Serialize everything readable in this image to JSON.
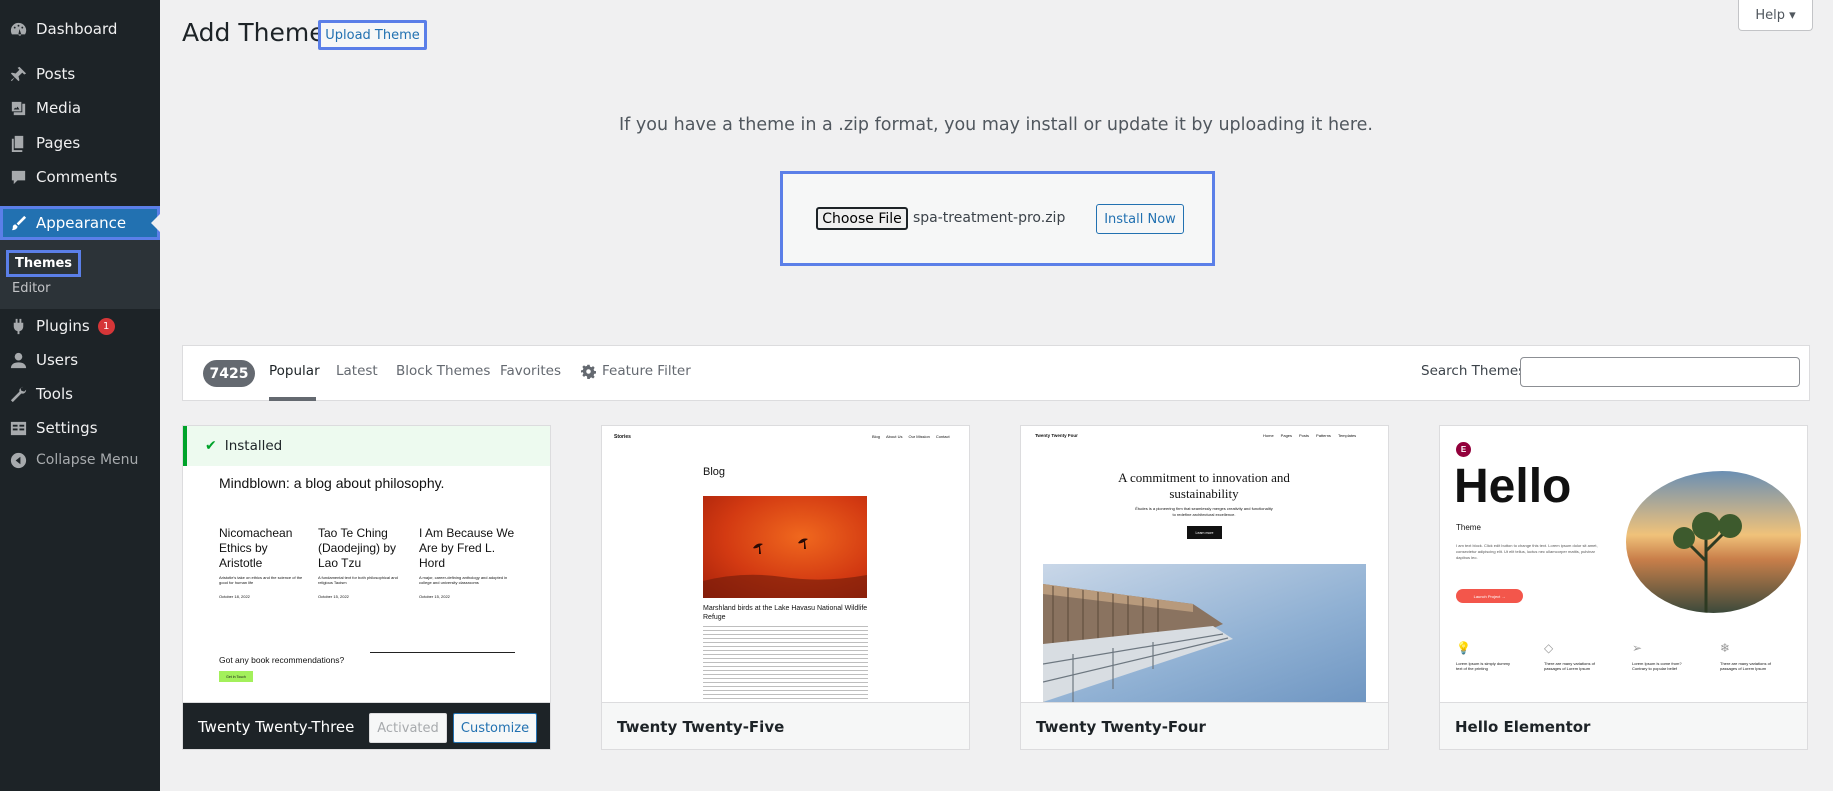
{
  "sidebar": {
    "items": [
      {
        "label": "Dashboard",
        "icon": "dashboard-icon"
      },
      {
        "label": "Posts",
        "icon": "pin-icon"
      },
      {
        "label": "Media",
        "icon": "media-icon"
      },
      {
        "label": "Pages",
        "icon": "pages-icon"
      },
      {
        "label": "Comments",
        "icon": "comment-icon"
      },
      {
        "label": "Appearance",
        "icon": "brush-icon"
      },
      {
        "label": "Plugins",
        "icon": "plugin-icon",
        "badge": "1"
      },
      {
        "label": "Users",
        "icon": "users-icon"
      },
      {
        "label": "Tools",
        "icon": "wrench-icon"
      },
      {
        "label": "Settings",
        "icon": "settings-icon"
      },
      {
        "label": "Collapse Menu",
        "icon": "collapse-icon"
      }
    ],
    "submenu": [
      {
        "label": "Themes"
      },
      {
        "label": "Editor"
      }
    ]
  },
  "header": {
    "title": "Add Themes",
    "upload_button": "Upload Theme",
    "help_button": "Help ▾"
  },
  "upload": {
    "instructions": "If you have a theme in a .zip format, you may install or update it by uploading it here.",
    "choose_file": "Choose File",
    "file_name": "spa-treatment-pro.zip",
    "install_button": "Install Now"
  },
  "filter": {
    "count": "7425",
    "tabs": [
      "Popular",
      "Latest",
      "Block Themes",
      "Favorites"
    ],
    "feature_filter": "Feature Filter",
    "search_label": "Search Themes"
  },
  "themes": [
    {
      "name": "Twenty Twenty-Three",
      "installed": "Installed",
      "activated": "Activated",
      "customize": "Customize",
      "preview": {
        "heading": "Mindblown: a blog about philosophy.",
        "posts": [
          {
            "title": "Nicomachean Ethics by Aristotle",
            "text": "Aristotle's take on ethics and the science of the good for human life",
            "date": "October 18, 2022"
          },
          {
            "title": "Tao Te Ching (Daodejing) by Lao Tzu",
            "text": "A fundamental text for both philosophical and religious Taoism",
            "date": "October 15, 2022"
          },
          {
            "title": "I Am Because We Are by Fred L. Hord",
            "text": "A major, career-defining anthology and adopted in college and university classrooms",
            "date": "October 15, 2022"
          }
        ],
        "question": "Got any book recommendations?",
        "cta": "Get In Touch"
      }
    },
    {
      "name": "Twenty Twenty-Five",
      "preview": {
        "site": "Stories",
        "nav": [
          "Blog",
          "About Us",
          "Our Mission",
          "Contact"
        ],
        "heading": "Blog",
        "caption": "Marshland birds at the Lake Havasu National Wildlife Refuge"
      }
    },
    {
      "name": "Twenty Twenty-Four",
      "preview": {
        "site": "Twenty Twenty Four",
        "nav": [
          "Home",
          "Pages",
          "Posts",
          "Patterns",
          "Templates"
        ],
        "heading": "A commitment to innovation and sustainability",
        "text": "Études is a pioneering firm that seamlessly merges creativity and functionality to redefine architectural excellence.",
        "cta": "Learn more"
      }
    },
    {
      "name": "Hello Elementor",
      "preview": {
        "logo": "E",
        "heading": "Hello",
        "subheading": "Theme",
        "text": "I am text block. Click edit button to change this text. Lorem ipsum dolor sit amet, consectetur adipiscing elit. Ut elit tellus, luctus nec ullamcorper mattis, pulvinar dapibus leo.",
        "cta": "Launch Project →",
        "features": [
          {
            "icon": "bulb-icon",
            "text": "Lorem Ipsum is simply dummy text of the printing"
          },
          {
            "icon": "diamond-icon",
            "text": "There are many variations of passages of Lorem Ipsum"
          },
          {
            "icon": "paper-plane-icon",
            "text": "Lorem Ipsum is come from? Contrary to popular belief"
          },
          {
            "icon": "snowflake-icon",
            "text": "There are many variations of passages of Lorem Ipsum"
          }
        ]
      }
    }
  ],
  "colors": {
    "sidebar_bg": "#1d2327",
    "accent": "#2271b1",
    "highlight_outline": "#5b7fe8",
    "badge": "#d63638",
    "installed_green": "#00a32a"
  }
}
